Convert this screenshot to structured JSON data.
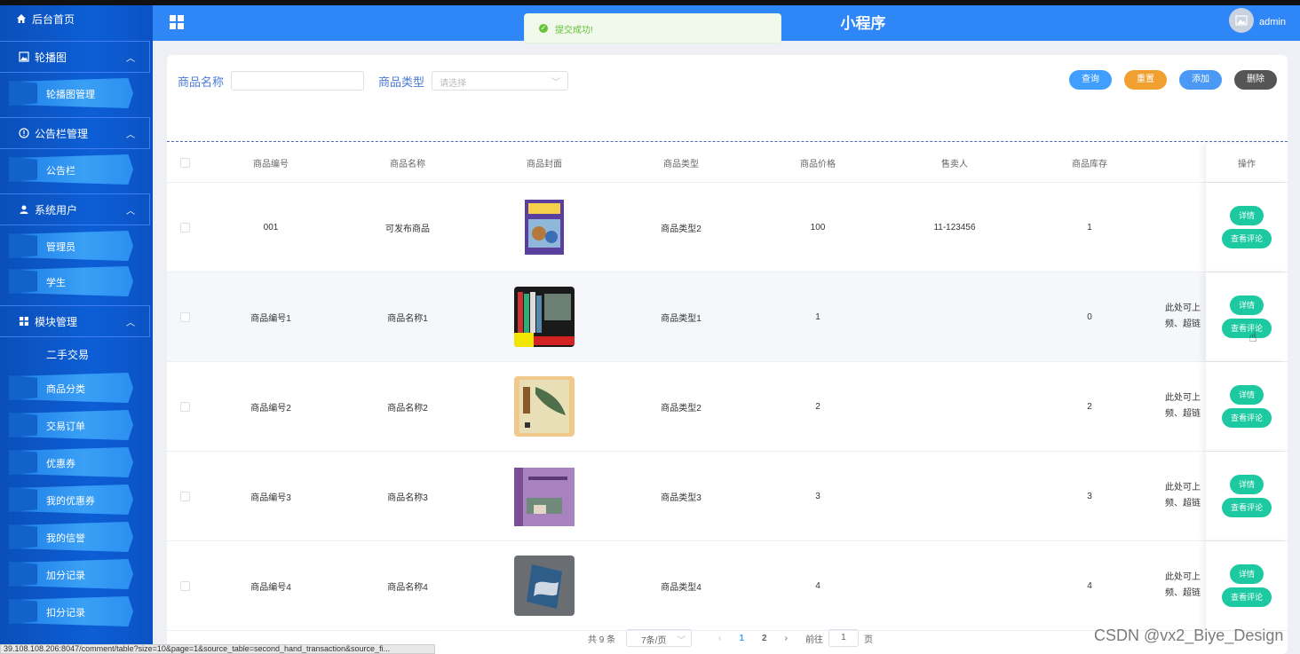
{
  "sidebar": {
    "home": "后台首页",
    "groups": [
      {
        "label": "轮播图",
        "items": [
          "轮播图管理"
        ]
      },
      {
        "label": "公告栏管理",
        "items": [
          "公告栏"
        ]
      },
      {
        "label": "系统用户",
        "items": [
          "管理员",
          "学生"
        ]
      },
      {
        "label": "模块管理",
        "plain": "二手交易",
        "items": [
          "商品分类",
          "交易订单",
          "优惠券",
          "我的优惠券",
          "我的信誉",
          "加分记录",
          "扣分记录"
        ]
      }
    ]
  },
  "header": {
    "title": "小程序",
    "user": "admin"
  },
  "toast": {
    "text": "提交成功!"
  },
  "search": {
    "name_label": "商品名称",
    "name_value": "",
    "type_label": "商品类型",
    "type_placeholder": "请选择"
  },
  "buttons": {
    "query": "查询",
    "reset": "重置",
    "add": "添加",
    "delete": "删除"
  },
  "table": {
    "headers": {
      "id": "商品编号",
      "name": "商品名称",
      "cover": "商品封面",
      "type": "商品类型",
      "price": "商品价格",
      "seller": "售卖人",
      "stock": "商品库存",
      "ops": "操作"
    },
    "rows": [
      {
        "id": "001",
        "name": "可发布商品",
        "type": "商品类型2",
        "price": "100",
        "seller": "11-123456",
        "stock": "1",
        "desc1": "",
        "desc2": ""
      },
      {
        "id": "商品编号1",
        "name": "商品名称1",
        "type": "商品类型1",
        "price": "1",
        "seller": "",
        "stock": "0",
        "desc1": "此处可上",
        "desc2": "频、超链"
      },
      {
        "id": "商品编号2",
        "name": "商品名称2",
        "type": "商品类型2",
        "price": "2",
        "seller": "",
        "stock": "2",
        "desc1": "此处可上",
        "desc2": "频、超链"
      },
      {
        "id": "商品编号3",
        "name": "商品名称3",
        "type": "商品类型3",
        "price": "3",
        "seller": "",
        "stock": "3",
        "desc1": "此处可上",
        "desc2": "频、超链"
      },
      {
        "id": "商品编号4",
        "name": "商品名称4",
        "type": "商品类型4",
        "price": "4",
        "seller": "",
        "stock": "4",
        "desc1": "此处可上",
        "desc2": "频、超链"
      }
    ],
    "op_detail": "详情",
    "op_comments": "查看评论"
  },
  "pager": {
    "total": "共 9 条",
    "size": "7条/页",
    "pages": [
      "1",
      "2"
    ],
    "goto": "前往",
    "goto_value": "1",
    "page_unit": "页"
  },
  "statusbar": "39.108.108.206:8047/comment/table?size=10&page=1&source_table=second_hand_transaction&source_fi...",
  "watermark": "CSDN @vx2_Biye_Design",
  "colors": {
    "primary": "#409eff",
    "header": "#2f86f6",
    "sidebar": "#0c5ed6",
    "op_button": "#1cc9a0",
    "reset": "#f0a030"
  }
}
